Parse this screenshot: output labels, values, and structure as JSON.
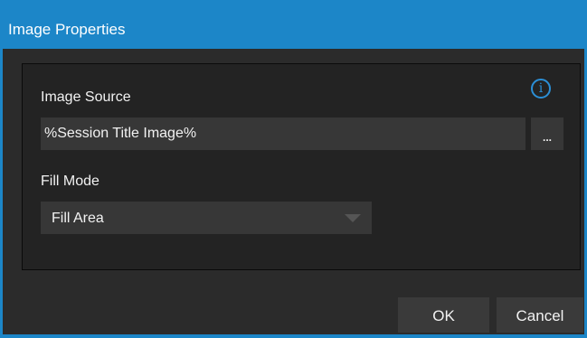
{
  "window": {
    "title": "Image Properties"
  },
  "image_source": {
    "label": "Image Source",
    "value": "%Session Title Image%",
    "browse_label": "..."
  },
  "fill_mode": {
    "label": "Fill Mode",
    "selected": "Fill Area"
  },
  "info_icon": {
    "icon": "info-icon",
    "glyph": "i"
  },
  "buttons": {
    "ok": "OK",
    "cancel": "Cancel"
  },
  "colors": {
    "accent": "#1c86c8",
    "background": "#2b2b2b",
    "field": "#373737"
  }
}
